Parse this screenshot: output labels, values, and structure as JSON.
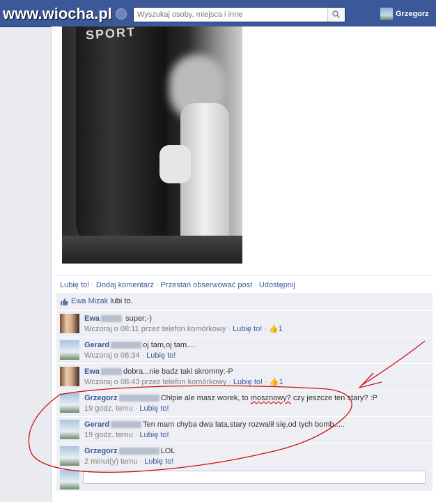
{
  "header": {
    "logo": "www.wiocha.pl",
    "search_placeholder": "Wyszukaj osoby, miejsca i inne",
    "user_name": "Grzegorz"
  },
  "photo": {
    "text_on_bag": "SPORT"
  },
  "actions": {
    "like": "Lubię to!",
    "comment": "Dodaj komentarz",
    "unfollow": "Przestań obserwować post",
    "share": "Udostępnij"
  },
  "likes": {
    "name": "Ewa Mizak",
    "suffix": "lubi to."
  },
  "comments": [
    {
      "author": "Ewa",
      "text": "super;-)",
      "time": "Wczoraj o 08:11 przez telefon komórkowy",
      "like": "Lubię to!",
      "count": "1",
      "avatar": "ewa"
    },
    {
      "author": "Gerard",
      "text": "oj tam,oj tam....",
      "time": "Wczoraj o 08:34",
      "like": "Lubię to!",
      "avatar": "gerard"
    },
    {
      "author": "Ewa",
      "text": "dobra...nie badz taki skromny:-P",
      "time": "Wczoraj o 08:43 przez telefon komórkowy",
      "like": "Lubię to!",
      "count": "1",
      "avatar": "ewa"
    },
    {
      "author": "Grzegorz",
      "text_before": "Chłpie ale masz worek, to ",
      "text_underlined": "mosznowy?",
      "text_after": " czy jeszcze ten stary? :P",
      "time": "19 godz. temu",
      "like": "Lubię to!",
      "avatar": "grzegorz"
    },
    {
      "author": "Gerard",
      "text": "Ten mam chyba dwa lata,stary rozwalił się,od tych bomb.....",
      "time": "19 godz. temu",
      "like": "Lubię to!",
      "avatar": "gerard"
    },
    {
      "author": "Grzegorz",
      "text": "LOL",
      "time": "2 minut(y) temu",
      "like": "Lubię to!",
      "avatar": "grzegorz"
    }
  ],
  "colors": {
    "facebook_blue": "#3b5998",
    "annotation_red": "#cc1111"
  }
}
